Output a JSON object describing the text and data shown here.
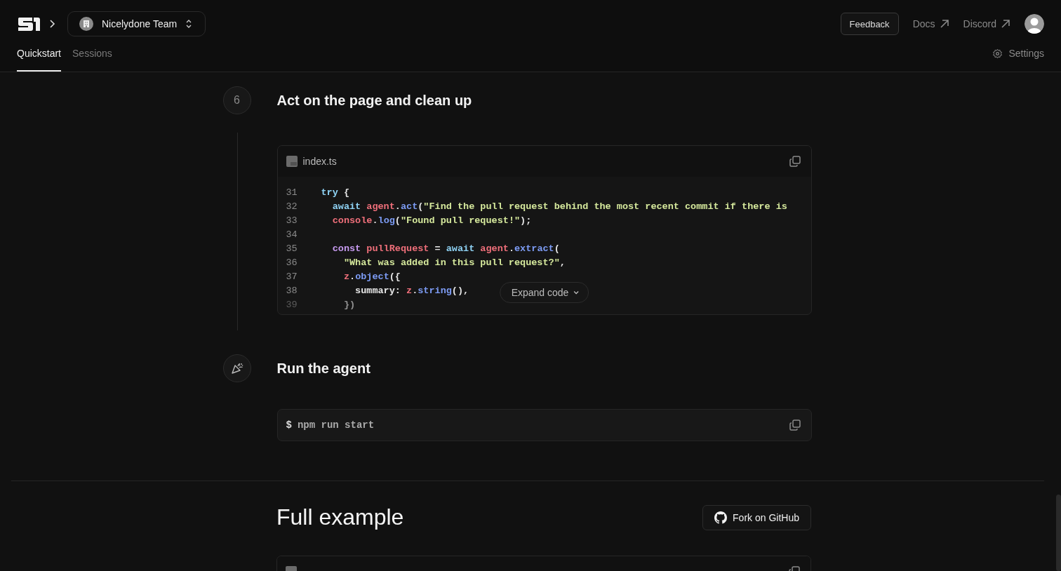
{
  "header": {
    "team": "Nicelydone Team",
    "feedback": "Feedback",
    "links": [
      {
        "label": "Docs"
      },
      {
        "label": "Discord"
      }
    ]
  },
  "tabs": [
    {
      "label": "Quickstart",
      "selected": true
    },
    {
      "label": "Sessions",
      "selected": false
    }
  ],
  "settings": "Settings",
  "steps": [
    {
      "marker": "6",
      "kind": "number",
      "title": "Act on the page and clean up",
      "block": {
        "kind": "file",
        "filename": "index.ts",
        "expand": "Expand code",
        "lines": [
          {
            "n": "31",
            "tokens": [
              {
                "text": "try",
                "kind": "keyword"
              },
              {
                "text": " {",
                "kind": "punct"
              }
            ]
          },
          {
            "n": "32",
            "tokens": [
              {
                "text": "  await",
                "kind": "keyword"
              },
              {
                "text": " agent",
                "kind": "variable"
              },
              {
                "text": ".",
                "kind": "punct"
              },
              {
                "text": "act",
                "kind": "function"
              },
              {
                "text": "(",
                "kind": "punct"
              },
              {
                "text": "\"Find the pull request behind the most recent commit if there is",
                "kind": "string"
              }
            ]
          },
          {
            "n": "33",
            "tokens": [
              {
                "text": "  console",
                "kind": "variable"
              },
              {
                "text": ".",
                "kind": "punct"
              },
              {
                "text": "log",
                "kind": "function"
              },
              {
                "text": "(",
                "kind": "punct"
              },
              {
                "text": "\"Found pull request!\"",
                "kind": "string"
              },
              {
                "text": ");",
                "kind": "punct"
              }
            ]
          },
          {
            "n": "34"
          },
          {
            "n": "35",
            "tokens": [
              {
                "text": "  const",
                "kind": "declaration"
              },
              {
                "text": " pullRequest",
                "kind": "variable"
              },
              {
                "text": " = ",
                "kind": "punct"
              },
              {
                "text": "await",
                "kind": "keyword"
              },
              {
                "text": " agent",
                "kind": "variable"
              },
              {
                "text": ".",
                "kind": "punct"
              },
              {
                "text": "extract",
                "kind": "function"
              },
              {
                "text": "(",
                "kind": "punct"
              }
            ]
          },
          {
            "n": "36",
            "tokens": [
              {
                "text": "    \"What was added in this pull request?\"",
                "kind": "string"
              },
              {
                "text": ",",
                "kind": "punct"
              }
            ]
          },
          {
            "n": "37",
            "tokens": [
              {
                "text": "    z",
                "kind": "variable"
              },
              {
                "text": ".",
                "kind": "punct"
              },
              {
                "text": "object",
                "kind": "function"
              },
              {
                "text": "({",
                "kind": "punct"
              }
            ]
          },
          {
            "n": "38",
            "tokens": [
              {
                "text": "      summary",
                "kind": "plain"
              },
              {
                "text": ": ",
                "kind": "punct"
              },
              {
                "text": "z",
                "kind": "variable"
              },
              {
                "text": ".",
                "kind": "punct"
              },
              {
                "text": "string",
                "kind": "function"
              },
              {
                "text": "(),",
                "kind": "punct"
              }
            ]
          },
          {
            "n": "39",
            "tokens": [
              {
                "text": "    })",
                "kind": "punct"
              }
            ]
          }
        ]
      }
    },
    {
      "kind": "party",
      "title": "Run the agent",
      "block": {
        "kind": "command",
        "prompt": "$",
        "command": "npm run start"
      }
    }
  ],
  "full_example": {
    "title": "Full example",
    "button": "Fork on GitHub"
  }
}
